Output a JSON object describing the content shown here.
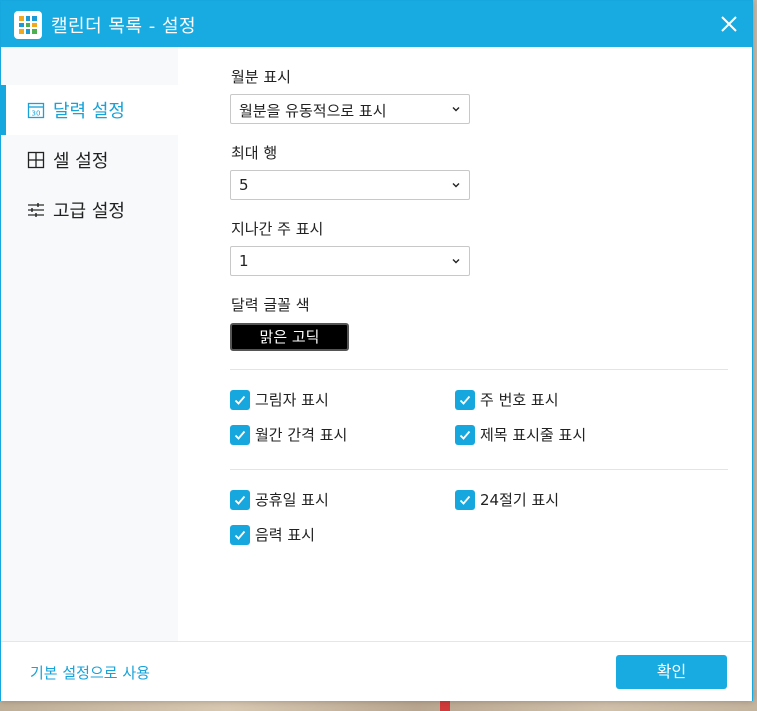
{
  "window": {
    "title": "캘린더 목록 - 설정",
    "accent_color": "#17abe2"
  },
  "sidebar": {
    "items": [
      {
        "label": "달력 설정",
        "icon": "calendar-icon",
        "active": true
      },
      {
        "label": "셀 설정",
        "icon": "grid-icon",
        "active": false
      },
      {
        "label": "고급 설정",
        "icon": "sliders-icon",
        "active": false
      }
    ]
  },
  "settings": {
    "month_display": {
      "label": "월분 표시",
      "value": "월분을 유동적으로 표시"
    },
    "max_rows": {
      "label": "최대 행",
      "value": "5"
    },
    "past_weeks": {
      "label": "지나간 주 표시",
      "value": "1"
    },
    "font_color": {
      "label": "달력 글꼴 색",
      "button_label": "맑은 고딕",
      "swatch": "#000000"
    }
  },
  "checkboxes": {
    "shadow": {
      "label": "그림자 표시",
      "checked": true
    },
    "week_number": {
      "label": "주 번호 표시",
      "checked": true
    },
    "month_gap": {
      "label": "월간 간격 표시",
      "checked": true
    },
    "title_bar": {
      "label": "제목 표시줄 표시",
      "checked": true
    },
    "holidays": {
      "label": "공휴일 표시",
      "checked": true
    },
    "solar_terms": {
      "label": "24절기 표시",
      "checked": true
    },
    "lunar": {
      "label": "음력 표시",
      "checked": true
    }
  },
  "footer": {
    "reset_label": "기본 설정으로 사용",
    "ok_label": "확인"
  }
}
